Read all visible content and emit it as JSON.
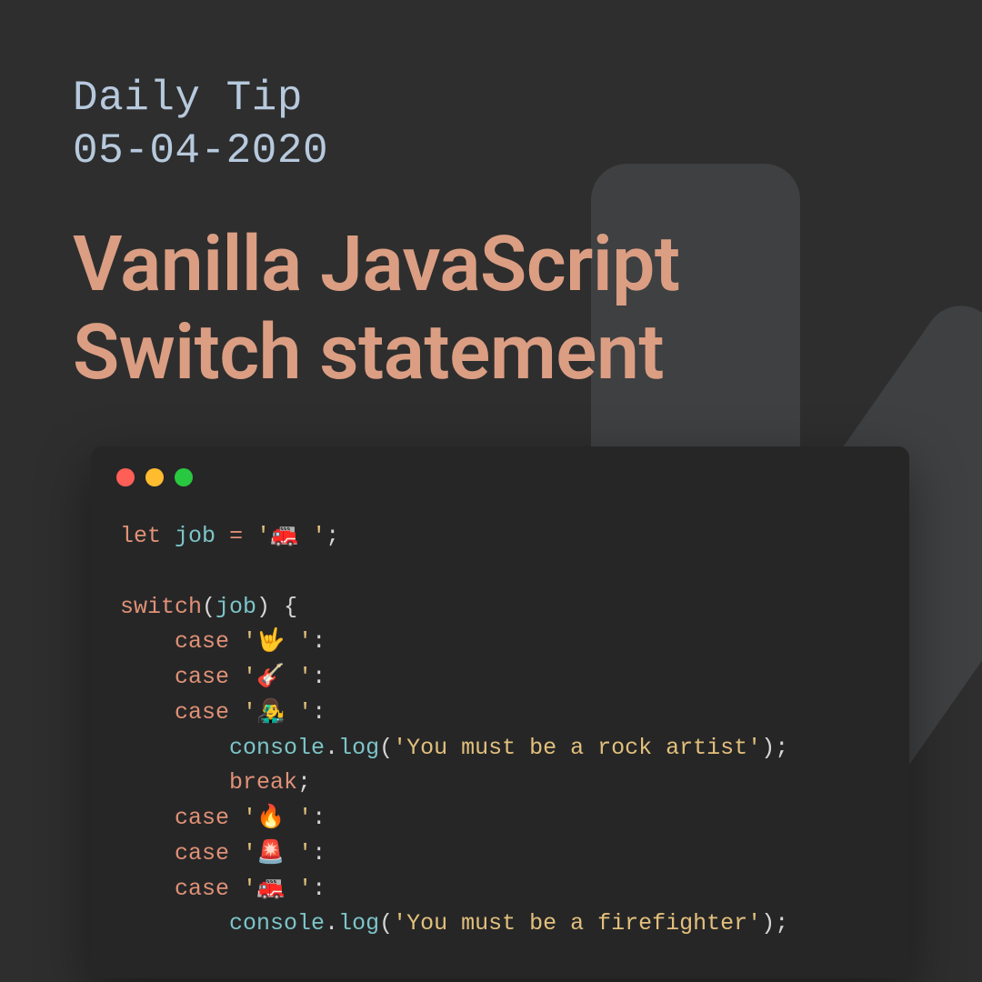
{
  "header": {
    "label_line1": "Daily Tip",
    "label_line2": "05-04-2020",
    "title_line1": "Vanilla JavaScript",
    "title_line2": "Switch statement"
  },
  "window": {
    "dots": [
      "red",
      "yellow",
      "green"
    ]
  },
  "code": {
    "let": "let",
    "var_name": "job",
    "assign": "=",
    "job_value": "'🚒 '",
    "semi": ";",
    "switch": "switch",
    "lparen": "(",
    "rparen": ")",
    "lbrace": "{",
    "case": "case",
    "colon": ":",
    "case1": "'🤟 '",
    "case2": "'🎸 '",
    "case3": "'👨‍🎤 '",
    "console": "console",
    "dot": ".",
    "log": "log",
    "msg1": "'You must be a rock artist'",
    "break": "break",
    "case4": "'🔥 '",
    "case5": "'🚨 '",
    "case6": "'🚒 '",
    "msg2": "'You must be a firefighter'"
  }
}
